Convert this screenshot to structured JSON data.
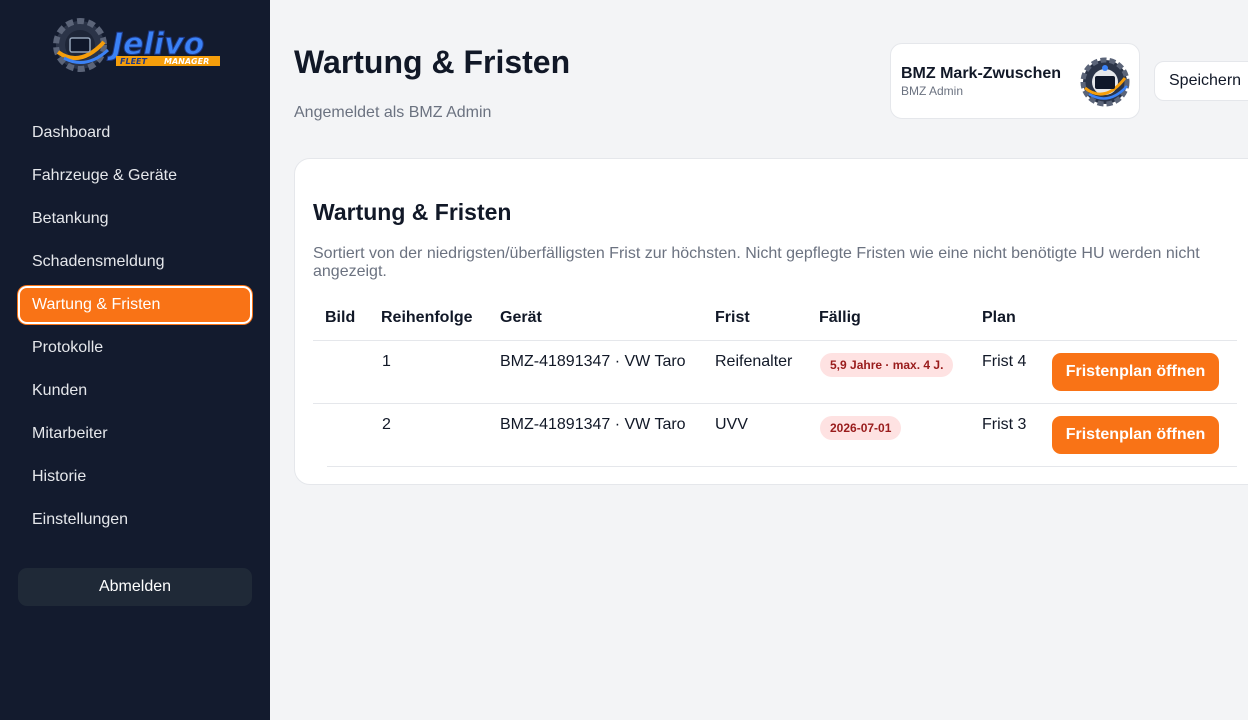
{
  "brand": {
    "logo_name": "Jelivo",
    "logo_tag1": "FLEET",
    "logo_tag2": "MANAGER"
  },
  "sidebar": {
    "items": [
      {
        "label": "Dashboard"
      },
      {
        "label": "Fahrzeuge & Geräte"
      },
      {
        "label": "Betankung"
      },
      {
        "label": "Schadensmeldung"
      },
      {
        "label": "Wartung & Fristen",
        "active": true
      },
      {
        "label": "Protokolle"
      },
      {
        "label": "Kunden"
      },
      {
        "label": "Mitarbeiter"
      },
      {
        "label": "Historie"
      },
      {
        "label": "Einstellungen"
      }
    ],
    "logout_label": "Abmelden"
  },
  "header": {
    "title": "Wartung & Fristen",
    "subtitle": "Angemeldet als BMZ Admin",
    "save_label": "Speichern"
  },
  "user": {
    "name": "BMZ Mark-Zwuschen",
    "role": "BMZ Admin"
  },
  "main": {
    "title": "Wartung & Fristen",
    "description": "Sortiert von der niedrigsten/überfälligsten Frist zur höchsten. Nicht gepflegte Fristen wie eine nicht benötigte HU werden nicht angezeigt.",
    "columns": {
      "bild": "Bild",
      "reihenfolge": "Reihenfolge",
      "geraet": "Gerät",
      "frist": "Frist",
      "faellig": "Fällig",
      "plan": "Plan"
    },
    "rows": [
      {
        "order": "1",
        "device": "BMZ-41891347 · VW Taro",
        "frist": "Reifenalter",
        "due": "5,9 Jahre · max. 4 J.",
        "plan": "Frist 4",
        "action": "Fristenplan öffnen"
      },
      {
        "order": "2",
        "device": "BMZ-41891347 · VW Taro",
        "frist": "UVV",
        "due": "2026-07-01",
        "plan": "Frist 3",
        "action": "Fristenplan öffnen"
      }
    ]
  },
  "colors": {
    "sidebar_bg": "#131b2e",
    "accent": "#f97316",
    "badge_bg": "#fee2e2",
    "badge_text": "#991b1b"
  }
}
